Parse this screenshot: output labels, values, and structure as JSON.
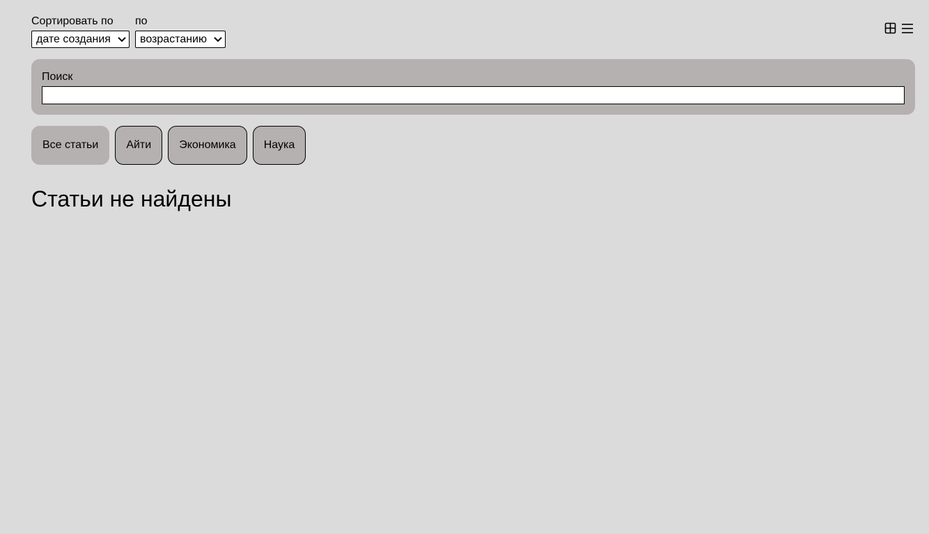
{
  "sort": {
    "field_label": "Сортировать по",
    "field_value": "дате создания",
    "order_label": "по",
    "order_value": "возрастанию"
  },
  "view_toggle": {
    "grid_icon": "grid-icon",
    "list_icon": "list-icon"
  },
  "search": {
    "label": "Поиск",
    "value": "",
    "placeholder": ""
  },
  "tabs": [
    {
      "label": "Все статьи",
      "active": true
    },
    {
      "label": "Айти",
      "active": false
    },
    {
      "label": "Экономика",
      "active": false
    },
    {
      "label": "Наука",
      "active": false
    }
  ],
  "main": {
    "empty_message": "Статьи не найдены"
  }
}
